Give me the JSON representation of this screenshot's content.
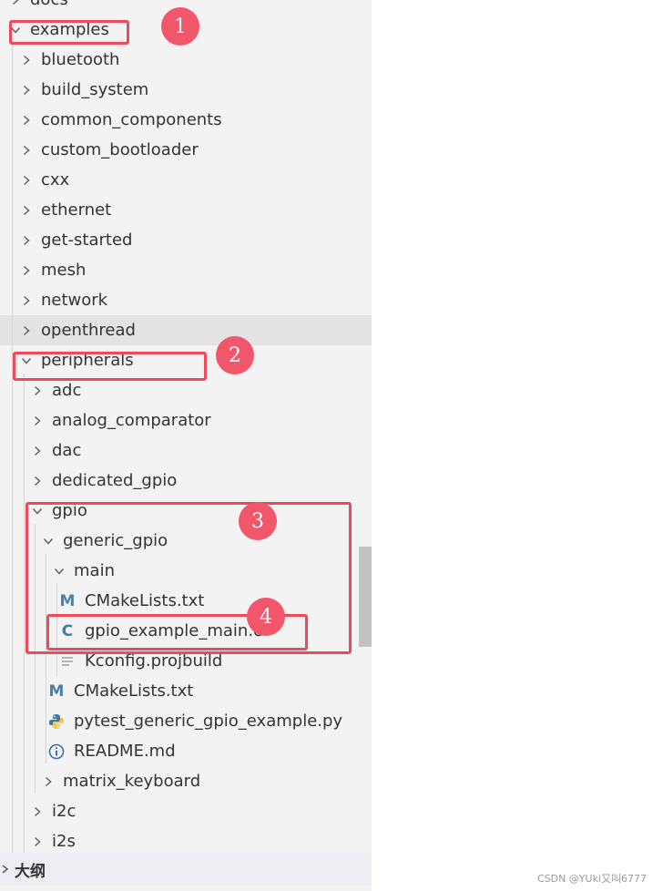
{
  "explorer": {
    "items": [
      {
        "label": "docs",
        "depth": 0,
        "type": "folder",
        "expanded": false
      },
      {
        "label": "examples",
        "depth": 0,
        "type": "folder",
        "expanded": true
      },
      {
        "label": "bluetooth",
        "depth": 1,
        "type": "folder",
        "expanded": false
      },
      {
        "label": "build_system",
        "depth": 1,
        "type": "folder",
        "expanded": false
      },
      {
        "label": "common_components",
        "depth": 1,
        "type": "folder",
        "expanded": false
      },
      {
        "label": "custom_bootloader",
        "depth": 1,
        "type": "folder",
        "expanded": false
      },
      {
        "label": "cxx",
        "depth": 1,
        "type": "folder",
        "expanded": false
      },
      {
        "label": "ethernet",
        "depth": 1,
        "type": "folder",
        "expanded": false
      },
      {
        "label": "get-started",
        "depth": 1,
        "type": "folder",
        "expanded": false
      },
      {
        "label": "mesh",
        "depth": 1,
        "type": "folder",
        "expanded": false
      },
      {
        "label": "network",
        "depth": 1,
        "type": "folder",
        "expanded": false
      },
      {
        "label": "openthread",
        "depth": 1,
        "type": "folder",
        "expanded": false,
        "selected": true
      },
      {
        "label": "peripherals",
        "depth": 1,
        "type": "folder",
        "expanded": true
      },
      {
        "label": "adc",
        "depth": 2,
        "type": "folder",
        "expanded": false
      },
      {
        "label": "analog_comparator",
        "depth": 2,
        "type": "folder",
        "expanded": false
      },
      {
        "label": "dac",
        "depth": 2,
        "type": "folder",
        "expanded": false
      },
      {
        "label": "dedicated_gpio",
        "depth": 2,
        "type": "folder",
        "expanded": false
      },
      {
        "label": "gpio",
        "depth": 2,
        "type": "folder",
        "expanded": true
      },
      {
        "label": "generic_gpio",
        "depth": 3,
        "type": "folder",
        "expanded": true
      },
      {
        "label": "main",
        "depth": 4,
        "type": "folder",
        "expanded": true
      },
      {
        "label": "CMakeLists.txt",
        "depth": 5,
        "type": "file",
        "icon": "cmake-icon"
      },
      {
        "label": "gpio_example_main.c",
        "depth": 5,
        "type": "file",
        "icon": "c-file-icon"
      },
      {
        "label": "Kconfig.projbuild",
        "depth": 5,
        "type": "file",
        "icon": "text-file-icon"
      },
      {
        "label": "CMakeLists.txt",
        "depth": 4,
        "type": "file",
        "icon": "cmake-icon"
      },
      {
        "label": "pytest_generic_gpio_example.py",
        "depth": 4,
        "type": "file",
        "icon": "python-icon"
      },
      {
        "label": "README.md",
        "depth": 4,
        "type": "file",
        "icon": "info-icon"
      },
      {
        "label": "matrix_keyboard",
        "depth": 3,
        "type": "folder",
        "expanded": false
      },
      {
        "label": "i2c",
        "depth": 2,
        "type": "folder",
        "expanded": false
      },
      {
        "label": "i2s",
        "depth": 2,
        "type": "folder",
        "expanded": false
      }
    ]
  },
  "outline": {
    "label": "大纲"
  },
  "annotations": [
    "1",
    "2",
    "3",
    "4"
  ],
  "watermark": "CSDN @YUki又叫6777",
  "colors": {
    "annotation": "#ee4a5b",
    "cmake_icon": "#4f7ea6",
    "c_icon": "#3f7ea8",
    "python_blue": "#3c78aa",
    "python_yellow": "#f2c94c",
    "info_icon": "#3c6ea8"
  }
}
